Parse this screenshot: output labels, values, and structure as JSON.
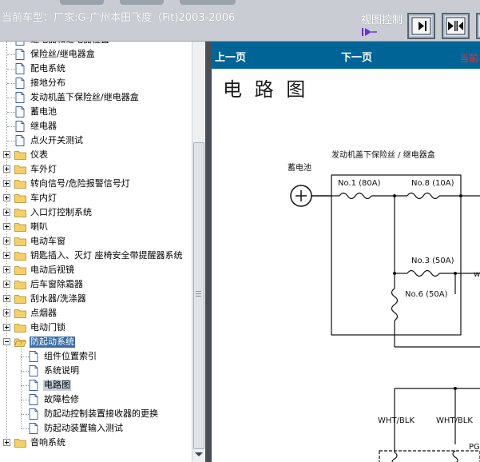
{
  "header": {
    "title": "当前车型：厂家:G-广州本田飞度（Fit)2003-2006",
    "view_control_label": "视图控制"
  },
  "toolbar": {
    "buttons": [
      {
        "icon": "collapse-left-pane-icon"
      },
      {
        "icon": "split-view-icon"
      }
    ]
  },
  "tree": {
    "items": [
      {
        "label": "继电器和继电器位置",
        "kind": "doc"
      },
      {
        "label": "保险丝/继电器盒",
        "kind": "doc"
      },
      {
        "label": "配电系统",
        "kind": "doc"
      },
      {
        "label": "接地分布",
        "kind": "doc"
      },
      {
        "label": "发动机盖下保险丝/继电器盒",
        "kind": "doc"
      },
      {
        "label": "蓄电池",
        "kind": "doc"
      },
      {
        "label": "继电器",
        "kind": "doc"
      },
      {
        "label": "点火开关测试",
        "kind": "doc"
      },
      {
        "label": "仪表",
        "kind": "folder"
      },
      {
        "label": "车外灯",
        "kind": "folder"
      },
      {
        "label": "转向信号/危险报警信号灯",
        "kind": "folder"
      },
      {
        "label": "车内灯",
        "kind": "folder"
      },
      {
        "label": "入口灯控制系统",
        "kind": "folder"
      },
      {
        "label": "喇叭",
        "kind": "folder"
      },
      {
        "label": "电动车窗",
        "kind": "folder"
      },
      {
        "label": "钥匙插入、灭灯 座椅安全带提醒器系统",
        "kind": "folder"
      },
      {
        "label": "电动后视镜",
        "kind": "folder"
      },
      {
        "label": "后车窗除霜器",
        "kind": "folder"
      },
      {
        "label": "刮水器/洗涤器",
        "kind": "folder"
      },
      {
        "label": "点烟器",
        "kind": "folder"
      },
      {
        "label": "电动门锁",
        "kind": "folder"
      },
      {
        "label": "防起动系统",
        "kind": "folder-open",
        "selected": true
      },
      {
        "label": "组件位置索引",
        "kind": "child-doc"
      },
      {
        "label": "系统说明",
        "kind": "child-doc"
      },
      {
        "label": "电路图",
        "kind": "child-doc",
        "current": true
      },
      {
        "label": "故障检修",
        "kind": "child-doc"
      },
      {
        "label": "防起动控制装置接收器的更换",
        "kind": "child-doc"
      },
      {
        "label": "防起动装置输入测试",
        "kind": "child-doc"
      },
      {
        "label": "音响系统",
        "kind": "folder"
      }
    ]
  },
  "nav": {
    "prev_label": "上一页",
    "next_label": "下一页",
    "current_label": "当前"
  },
  "content": {
    "heading": "电 路 图",
    "diagram": {
      "box_title": "发动机盖下保险丝 / 继电器盒",
      "battery_label": "蓄电池",
      "fuses": [
        "No.1 (80A)",
        "No.8 (10A)",
        "No.3 (50A)",
        "No.6 (50A)"
      ],
      "wires": [
        "WHT/BLK",
        "WHT/BLK"
      ],
      "partial_label": "PG"
    }
  },
  "colors": {
    "nav_bar": "#006496",
    "selection": "#3a6ea5",
    "current_page_text": "#ff2a2a"
  }
}
